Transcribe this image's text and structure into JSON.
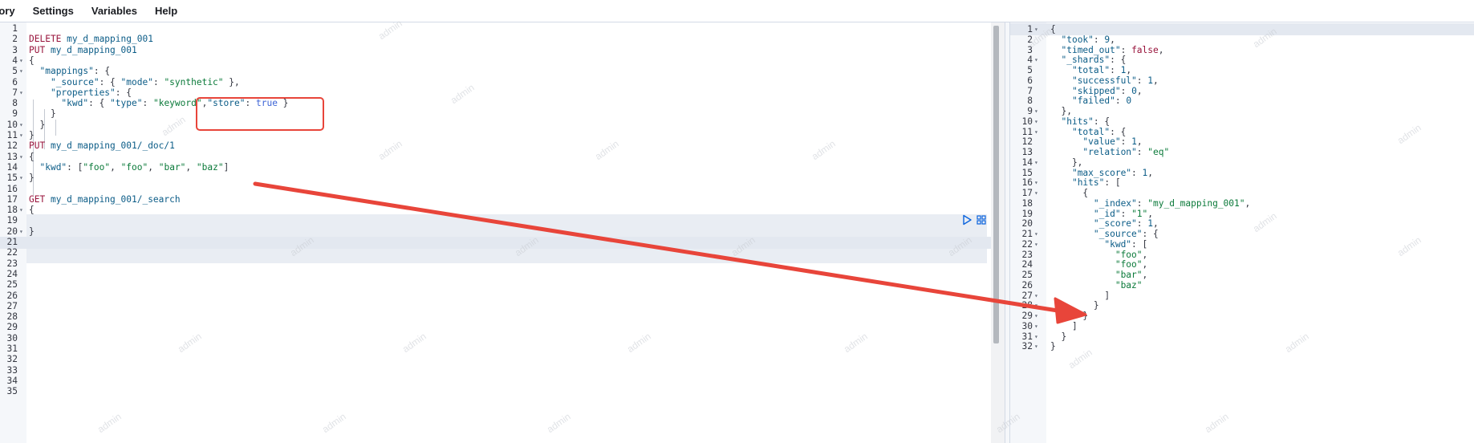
{
  "menu": {
    "items": [
      "tory",
      "Settings",
      "Variables",
      "Help"
    ]
  },
  "watermark": "admin",
  "request": {
    "lines": [
      {
        "n": "1",
        "html": ""
      },
      {
        "n": "2",
        "tokens": [
          [
            "k",
            "DELETE"
          ],
          [
            "u",
            " my_d_mapping_001"
          ]
        ]
      },
      {
        "n": "3",
        "tokens": [
          [
            "k",
            "PUT"
          ],
          [
            "u",
            " my_d_mapping_001"
          ]
        ]
      },
      {
        "n": "4",
        "fold": true,
        "tokens": [
          [
            "punc",
            "{"
          ]
        ]
      },
      {
        "n": "5",
        "fold": true,
        "tokens": [
          [
            "punc",
            "  "
          ],
          [
            "key",
            "\"mappings\""
          ],
          [
            "punc",
            ": {"
          ]
        ]
      },
      {
        "n": "6",
        "tokens": [
          [
            "punc",
            "    "
          ],
          [
            "key",
            "\"_source\""
          ],
          [
            "punc",
            ": { "
          ],
          [
            "key",
            "\"mode\""
          ],
          [
            "punc",
            ": "
          ],
          [
            "str",
            "\"synthetic\""
          ],
          [
            "punc",
            " },"
          ]
        ]
      },
      {
        "n": "7",
        "fold": true,
        "tokens": [
          [
            "punc",
            "    "
          ],
          [
            "key",
            "\"properties\""
          ],
          [
            "punc",
            ": {"
          ]
        ]
      },
      {
        "n": "8",
        "tokens": [
          [
            "punc",
            "      "
          ],
          [
            "key",
            "\"kwd\""
          ],
          [
            "punc",
            ": { "
          ],
          [
            "key",
            "\"type\""
          ],
          [
            "punc",
            ": "
          ],
          [
            "str",
            "\"keyword\""
          ],
          [
            "punc",
            ","
          ],
          [
            "key",
            "\"store\""
          ],
          [
            "punc",
            ": "
          ],
          [
            "bool",
            "true"
          ],
          [
            "punc",
            " }"
          ]
        ]
      },
      {
        "n": "9",
        "tokens": [
          [
            "punc",
            "    }"
          ]
        ]
      },
      {
        "n": "10",
        "fold": true,
        "tokens": [
          [
            "punc",
            "  }"
          ]
        ]
      },
      {
        "n": "11",
        "fold": true,
        "tokens": [
          [
            "punc",
            "}"
          ]
        ]
      },
      {
        "n": "12",
        "tokens": [
          [
            "k",
            "PUT"
          ],
          [
            "u",
            " my_d_mapping_001/_doc/1"
          ]
        ]
      },
      {
        "n": "13",
        "fold": true,
        "tokens": [
          [
            "punc",
            "{"
          ]
        ]
      },
      {
        "n": "14",
        "tokens": [
          [
            "punc",
            "  "
          ],
          [
            "key",
            "\"kwd\""
          ],
          [
            "punc",
            ": ["
          ],
          [
            "str",
            "\"foo\""
          ],
          [
            "punc",
            ", "
          ],
          [
            "str",
            "\"foo\""
          ],
          [
            "punc",
            ", "
          ],
          [
            "str",
            "\"bar\""
          ],
          [
            "punc",
            ", "
          ],
          [
            "str",
            "\"baz\""
          ],
          [
            "punc",
            "]"
          ]
        ]
      },
      {
        "n": "15",
        "fold": true,
        "tokens": [
          [
            "punc",
            "}"
          ]
        ]
      },
      {
        "n": "16",
        "tokens": []
      },
      {
        "n": "17",
        "tokens": [
          [
            "k",
            "GET"
          ],
          [
            "u",
            " my_d_mapping_001/_search"
          ]
        ]
      },
      {
        "n": "18",
        "fold": true,
        "tokens": [
          [
            "punc",
            "{"
          ]
        ]
      },
      {
        "n": "19",
        "tokens": []
      },
      {
        "n": "20",
        "fold": true,
        "tokens": [
          [
            "punc",
            "}"
          ]
        ]
      },
      {
        "n": "21",
        "tokens": []
      },
      {
        "n": "22",
        "tokens": []
      },
      {
        "n": "23",
        "tokens": []
      },
      {
        "n": "24",
        "tokens": []
      },
      {
        "n": "25",
        "tokens": []
      },
      {
        "n": "26",
        "tokens": []
      },
      {
        "n": "27",
        "tokens": []
      },
      {
        "n": "28",
        "tokens": []
      },
      {
        "n": "29",
        "tokens": []
      },
      {
        "n": "30",
        "tokens": []
      },
      {
        "n": "31",
        "tokens": []
      },
      {
        "n": "32",
        "tokens": []
      },
      {
        "n": "33",
        "tokens": []
      },
      {
        "n": "34",
        "tokens": []
      },
      {
        "n": "35",
        "tokens": []
      }
    ]
  },
  "response": {
    "lines": [
      {
        "n": "1",
        "fold": true,
        "tokens": [
          [
            "punc",
            "{"
          ]
        ]
      },
      {
        "n": "2",
        "tokens": [
          [
            "punc",
            "  "
          ],
          [
            "key",
            "\"took\""
          ],
          [
            "punc",
            ": "
          ],
          [
            "num",
            "9"
          ],
          [
            "punc",
            ","
          ]
        ]
      },
      {
        "n": "3",
        "tokens": [
          [
            "punc",
            "  "
          ],
          [
            "key",
            "\"timed_out\""
          ],
          [
            "punc",
            ": "
          ],
          [
            "k",
            "false"
          ],
          [
            "punc",
            ","
          ]
        ]
      },
      {
        "n": "4",
        "fold": true,
        "tokens": [
          [
            "punc",
            "  "
          ],
          [
            "key",
            "\"_shards\""
          ],
          [
            "punc",
            ": {"
          ]
        ]
      },
      {
        "n": "5",
        "tokens": [
          [
            "punc",
            "    "
          ],
          [
            "key",
            "\"total\""
          ],
          [
            "punc",
            ": "
          ],
          [
            "num",
            "1"
          ],
          [
            "punc",
            ","
          ]
        ]
      },
      {
        "n": "6",
        "tokens": [
          [
            "punc",
            "    "
          ],
          [
            "key",
            "\"successful\""
          ],
          [
            "punc",
            ": "
          ],
          [
            "num",
            "1"
          ],
          [
            "punc",
            ","
          ]
        ]
      },
      {
        "n": "7",
        "tokens": [
          [
            "punc",
            "    "
          ],
          [
            "key",
            "\"skipped\""
          ],
          [
            "punc",
            ": "
          ],
          [
            "num",
            "0"
          ],
          [
            "punc",
            ","
          ]
        ]
      },
      {
        "n": "8",
        "tokens": [
          [
            "punc",
            "    "
          ],
          [
            "key",
            "\"failed\""
          ],
          [
            "punc",
            ": "
          ],
          [
            "num",
            "0"
          ]
        ]
      },
      {
        "n": "9",
        "fold": true,
        "tokens": [
          [
            "punc",
            "  },"
          ]
        ]
      },
      {
        "n": "10",
        "fold": true,
        "tokens": [
          [
            "punc",
            "  "
          ],
          [
            "key",
            "\"hits\""
          ],
          [
            "punc",
            ": {"
          ]
        ]
      },
      {
        "n": "11",
        "fold": true,
        "tokens": [
          [
            "punc",
            "    "
          ],
          [
            "key",
            "\"total\""
          ],
          [
            "punc",
            ": {"
          ]
        ]
      },
      {
        "n": "12",
        "tokens": [
          [
            "punc",
            "      "
          ],
          [
            "key",
            "\"value\""
          ],
          [
            "punc",
            ": "
          ],
          [
            "num",
            "1"
          ],
          [
            "punc",
            ","
          ]
        ]
      },
      {
        "n": "13",
        "tokens": [
          [
            "punc",
            "      "
          ],
          [
            "key",
            "\"relation\""
          ],
          [
            "punc",
            ": "
          ],
          [
            "str",
            "\"eq\""
          ]
        ]
      },
      {
        "n": "14",
        "fold": true,
        "tokens": [
          [
            "punc",
            "    },"
          ]
        ]
      },
      {
        "n": "15",
        "tokens": [
          [
            "punc",
            "    "
          ],
          [
            "key",
            "\"max_score\""
          ],
          [
            "punc",
            ": "
          ],
          [
            "num",
            "1"
          ],
          [
            "punc",
            ","
          ]
        ]
      },
      {
        "n": "16",
        "fold": true,
        "tokens": [
          [
            "punc",
            "    "
          ],
          [
            "key",
            "\"hits\""
          ],
          [
            "punc",
            ": ["
          ]
        ]
      },
      {
        "n": "17",
        "fold": true,
        "tokens": [
          [
            "punc",
            "      {"
          ]
        ]
      },
      {
        "n": "18",
        "tokens": [
          [
            "punc",
            "        "
          ],
          [
            "key",
            "\"_index\""
          ],
          [
            "punc",
            ": "
          ],
          [
            "str",
            "\"my_d_mapping_001\""
          ],
          [
            "punc",
            ","
          ]
        ]
      },
      {
        "n": "19",
        "tokens": [
          [
            "punc",
            "        "
          ],
          [
            "key",
            "\"_id\""
          ],
          [
            "punc",
            ": "
          ],
          [
            "str",
            "\"1\""
          ],
          [
            "punc",
            ","
          ]
        ]
      },
      {
        "n": "20",
        "tokens": [
          [
            "punc",
            "        "
          ],
          [
            "key",
            "\"_score\""
          ],
          [
            "punc",
            ": "
          ],
          [
            "num",
            "1"
          ],
          [
            "punc",
            ","
          ]
        ]
      },
      {
        "n": "21",
        "fold": true,
        "tokens": [
          [
            "punc",
            "        "
          ],
          [
            "key",
            "\"_source\""
          ],
          [
            "punc",
            ": {"
          ]
        ]
      },
      {
        "n": "22",
        "fold": true,
        "tokens": [
          [
            "punc",
            "          "
          ],
          [
            "key",
            "\"kwd\""
          ],
          [
            "punc",
            ": ["
          ]
        ]
      },
      {
        "n": "23",
        "tokens": [
          [
            "punc",
            "            "
          ],
          [
            "str",
            "\"foo\""
          ],
          [
            "punc",
            ","
          ]
        ]
      },
      {
        "n": "24",
        "tokens": [
          [
            "punc",
            "            "
          ],
          [
            "str",
            "\"foo\""
          ],
          [
            "punc",
            ","
          ]
        ]
      },
      {
        "n": "25",
        "tokens": [
          [
            "punc",
            "            "
          ],
          [
            "str",
            "\"bar\""
          ],
          [
            "punc",
            ","
          ]
        ]
      },
      {
        "n": "26",
        "tokens": [
          [
            "punc",
            "            "
          ],
          [
            "str",
            "\"baz\""
          ]
        ]
      },
      {
        "n": "27",
        "fold": true,
        "tokens": [
          [
            "punc",
            "          ]"
          ]
        ]
      },
      {
        "n": "28",
        "fold": true,
        "tokens": [
          [
            "punc",
            "        }"
          ]
        ]
      },
      {
        "n": "29",
        "fold": true,
        "tokens": [
          [
            "punc",
            "      }"
          ]
        ]
      },
      {
        "n": "30",
        "fold": true,
        "tokens": [
          [
            "punc",
            "    ]"
          ]
        ]
      },
      {
        "n": "31",
        "fold": true,
        "tokens": [
          [
            "punc",
            "  }"
          ]
        ]
      },
      {
        "n": "32",
        "fold": true,
        "tokens": [
          [
            "punc",
            "}"
          ]
        ]
      }
    ]
  }
}
